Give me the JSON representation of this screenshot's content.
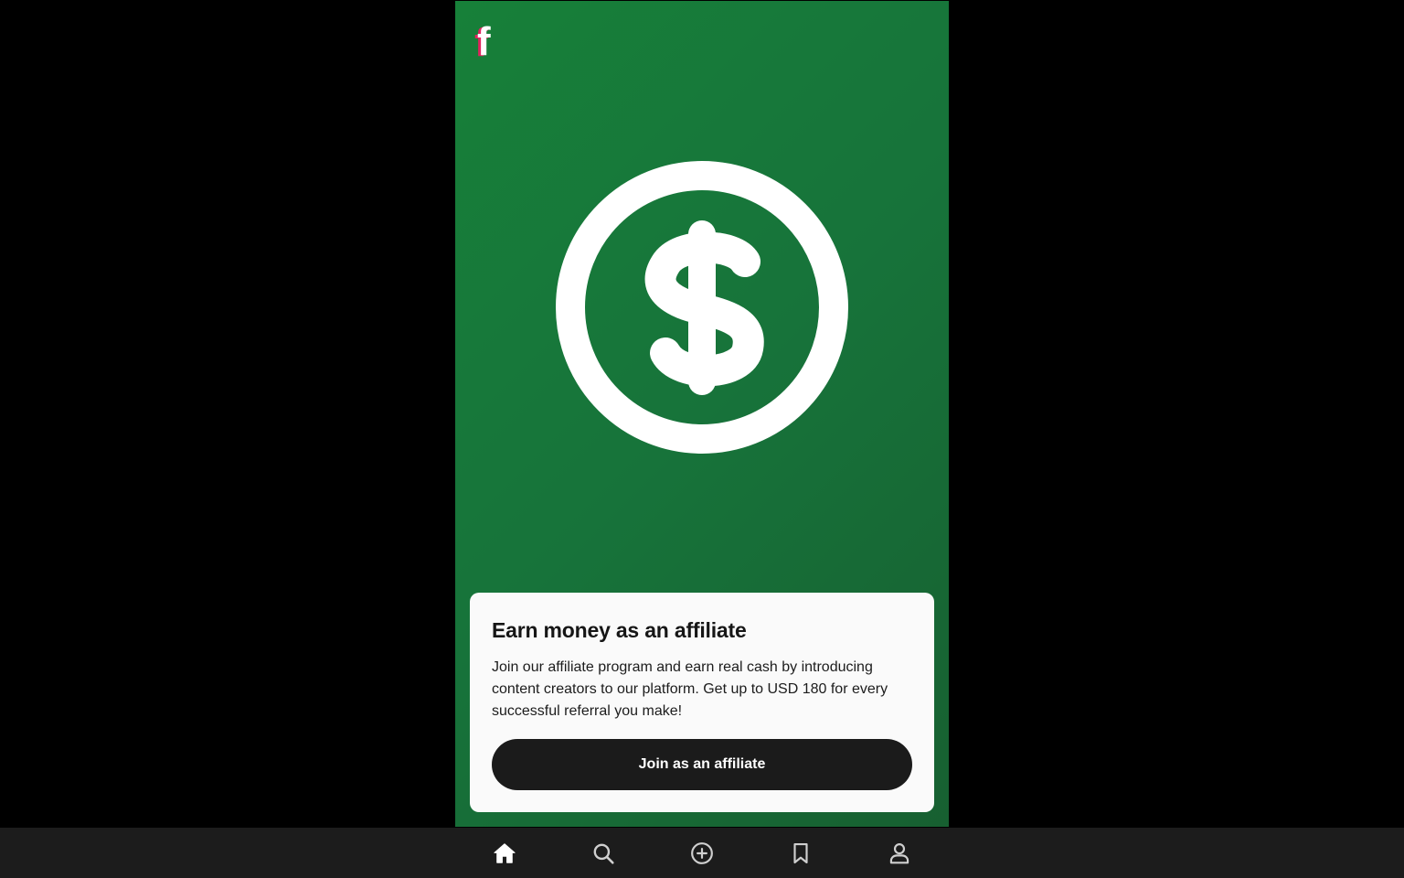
{
  "brand": {
    "logo_letter": "f",
    "logo_icon": "brand-f-logo-icon",
    "logo_color": "#ffffff",
    "logo_shadow_color": "#e0245e"
  },
  "hero": {
    "icon": "dollar-coin-icon",
    "background_colors": [
      "#178039",
      "#176031"
    ]
  },
  "card": {
    "title": "Earn money as an affiliate",
    "body": "Join our affiliate program and earn real cash by introducing content creators to our platform. Get up to USD 180 for every successful referral you make!",
    "cta_label": "Join as an affiliate"
  },
  "bottom_nav": {
    "active": "home",
    "items": [
      {
        "id": "home",
        "icon": "home-icon"
      },
      {
        "id": "search",
        "icon": "search-icon"
      },
      {
        "id": "create",
        "icon": "plus-circle-icon"
      },
      {
        "id": "saved",
        "icon": "bookmark-icon"
      },
      {
        "id": "profile",
        "icon": "user-icon"
      }
    ]
  },
  "colors": {
    "page_background": "#000000",
    "card_background": "#fafafa",
    "button_background": "#1b1b1b",
    "nav_background": "#1c1c1c",
    "nav_icon": "#cfcfcf",
    "nav_icon_active": "#ffffff"
  }
}
